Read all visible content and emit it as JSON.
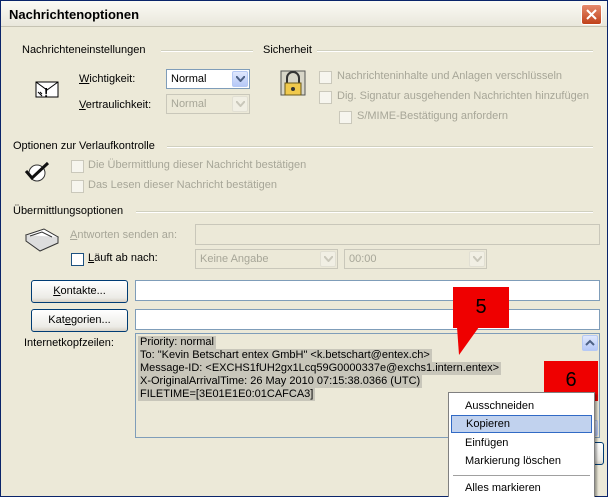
{
  "window": {
    "title": "Nachrichtenoptionen"
  },
  "msg_settings": {
    "group_title": "Nachrichteneinstellungen",
    "importance_label": "Wichtigkeit:",
    "importance_value": "Normal",
    "sensitivity_label": "Vertraulichkeit:",
    "sensitivity_value": "Normal"
  },
  "security": {
    "group_title": "Sicherheit",
    "encrypt_label": "Nachrichteninhalte und Anlagen verschlüsseln",
    "sign_label": "Dig. Signatur ausgehenden Nachrichten hinzufügen",
    "smime_label": "S/MIME-Bestätigung anfordern"
  },
  "tracking": {
    "group_title": "Optionen zur Verlaufkontrolle",
    "delivery_label": "Die Übermittlung dieser Nachricht bestätigen",
    "read_label": "Das Lesen dieser Nachricht bestätigen"
  },
  "delivery": {
    "group_title": "Übermittlungsoptionen",
    "reply_to_label": "Antworten senden an:",
    "expires_label": "Läuft ab nach:",
    "expires_date": "Keine Angabe",
    "expires_time": "00:00"
  },
  "buttons": {
    "contacts": "Kontakte...",
    "categories": "Kategorien..."
  },
  "internet_headers": {
    "label": "Internetkopfzeilen:",
    "lines": [
      "Priority: normal",
      "To: \"Kevin Betschart entex GmbH\" <k.betschart@entex.ch>",
      "Message-ID: <EXCHS1fUH2gx1Lcq59G0000337e@exchs1.intern.entex>",
      "X-OriginalArrivalTime: 26 May 2010 07:15:38.0366 (UTC)",
      "FILETIME=[3E01E1E0:01CAFCA3]"
    ]
  },
  "context_menu": {
    "items": [
      "Ausschneiden",
      "Kopieren",
      "Einfügen",
      "Markierung löschen",
      "Alles markieren"
    ],
    "highlighted": "Kopieren"
  },
  "annotations": {
    "step_a": "5",
    "step_b": "6",
    "color": "#ef0000"
  }
}
